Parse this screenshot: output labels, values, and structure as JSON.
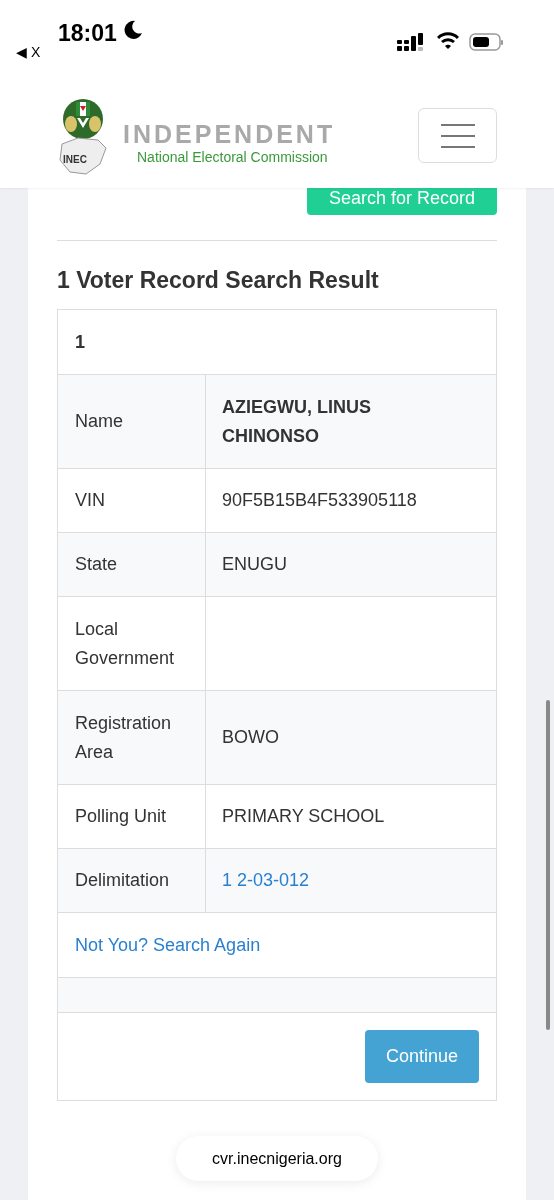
{
  "status_bar": {
    "time": "18:01",
    "back_label": "◀ X"
  },
  "header": {
    "logo_badge": "INEC",
    "logo_title": "INDEPENDENT",
    "logo_subtitle": "National Electoral Commission"
  },
  "search_button": "Search for Record",
  "result": {
    "heading": "1 Voter Record Search Result",
    "index": "1",
    "rows": [
      {
        "label": "Name",
        "value": "AZIEGWU, LINUS CHINONSO",
        "kind": "bold"
      },
      {
        "label": "VIN",
        "value": "90F5B15B4F533905118",
        "kind": "plain"
      },
      {
        "label": "State",
        "value": "ENUGU",
        "kind": "plain"
      },
      {
        "label": "Local Government"
      },
      {
        "label": "Registration Area",
        "value": "BOWO",
        "kind": "plain"
      },
      {
        "label": "Polling Unit",
        "value": "PRIMARY SCHOOL",
        "kind": "plain"
      },
      {
        "label": "Delimitation",
        "value": "1 2-03-012",
        "kind": "link"
      }
    ],
    "search_again": "Not You? Search Again",
    "continue": "Continue"
  },
  "url": "cvr.inecnigeria.org"
}
